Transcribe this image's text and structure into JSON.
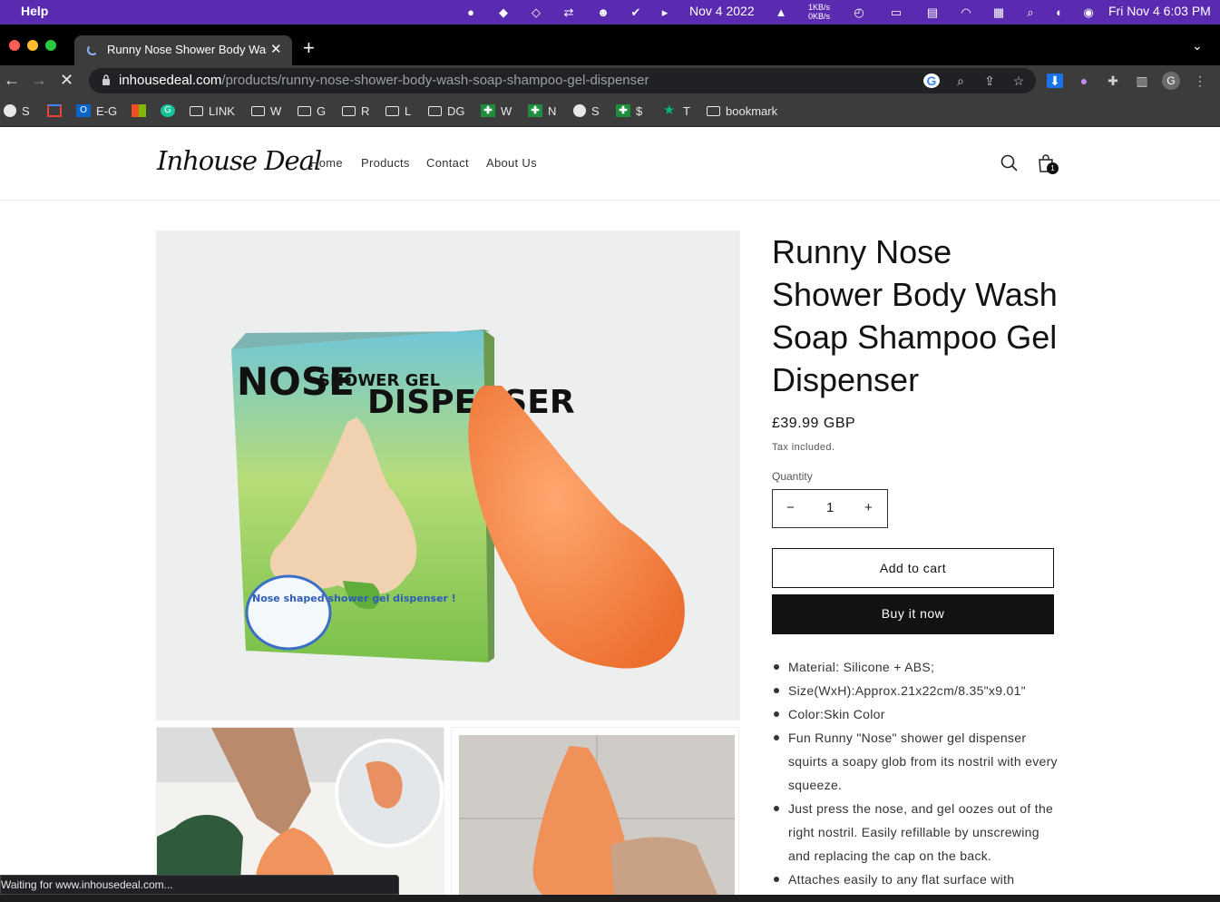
{
  "menubar": {
    "help": "Help",
    "date": "Nov 4 2022",
    "net_up": "1KB/s",
    "net_down": "0KB/s",
    "clock": "Fri Nov 4  6:03 PM"
  },
  "browser": {
    "tab_title": "Runny Nose Shower Body Wash Soap Shampoo Gel Dispenser",
    "url_domain": "inhousedeal.com",
    "url_path": "/products/runny-nose-shower-body-wash-soap-shampoo-gel-dispenser",
    "profile_initial": "G",
    "bookmarks": [
      "S",
      "",
      "E-G",
      "",
      "",
      "LINK",
      "W",
      "G",
      "R",
      "L",
      "DG",
      "W",
      "N",
      "S",
      "$",
      "T",
      "bookmark"
    ],
    "status_text": "Waiting for www.inhousedeal.com..."
  },
  "site": {
    "logo": "Inhouse Deal",
    "nav": [
      "Home",
      "Products",
      "Contact",
      "About Us"
    ],
    "cart_count": "1"
  },
  "product": {
    "title": "Runny Nose Shower Body Wash Soap Shampoo Gel Dispenser",
    "price": "£39.99 GBP",
    "tax_note": "Tax included.",
    "quantity_label": "Quantity",
    "quantity_value": "1",
    "decrease_symbol": "−",
    "increase_symbol": "+",
    "add_to_cart": "Add to cart",
    "buy_now": "Buy it now",
    "box_text_1": "NOSE",
    "box_text_2": "SHOWER GEL",
    "box_text_3": "DISPENSER",
    "box_badge": "Nose shaped shower gel dispenser !",
    "description": [
      "Material: Silicone + ABS;",
      "Size(WxH):Approx.21x22cm/8.35\"x9.01\"",
      "Color:Skin Color",
      "Fun Runny \"Nose\" shower gel dispenser squirts a soapy glob from its nostril with every squeeze.",
      "Just press the nose, and gel oozes out of the right nostril. Easily refillable by unscrewing and replacing the cap on the back.",
      "Attaches easily to any flat surface with"
    ]
  },
  "colors": {
    "menubar": "#5a2bb0",
    "chrome_dark": "#3c3c3c",
    "button_dark": "#121212",
    "nose_orange": "#f4874b"
  }
}
